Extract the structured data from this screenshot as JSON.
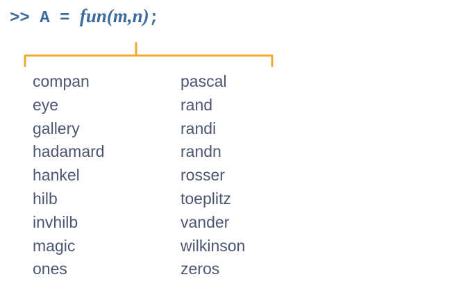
{
  "code": {
    "prompt": ">>",
    "lhs": "A",
    "op": "=",
    "call": "fun(m,n)",
    "end": ";"
  },
  "brace_color": "#f0a832",
  "functions_left": [
    "compan",
    "eye",
    "gallery",
    "hadamard",
    "hankel",
    "hilb",
    "invhilb",
    "magic",
    "ones"
  ],
  "functions_right": [
    "pascal",
    "rand",
    "randi",
    "randn",
    "rosser",
    "toeplitz",
    "vander",
    "wilkinson",
    "zeros"
  ]
}
